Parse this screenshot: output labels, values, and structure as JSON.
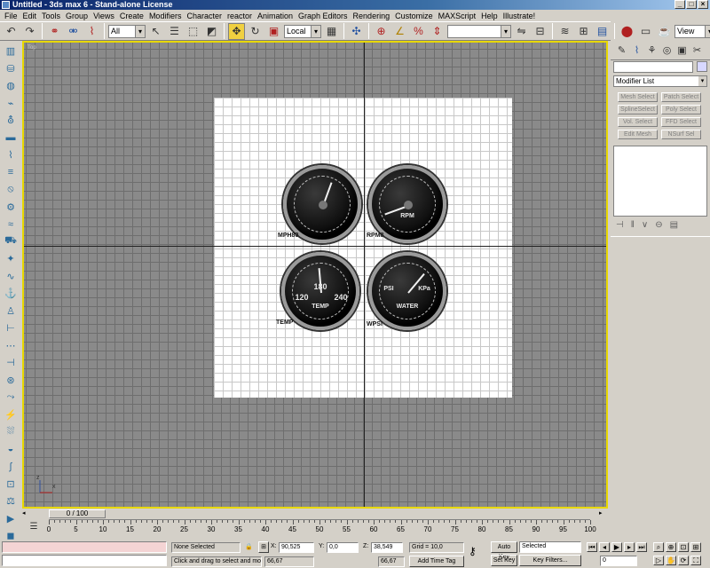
{
  "window": {
    "title": "Untitled - 3ds max 6 - Stand-alone License",
    "buttons": [
      "_",
      "□",
      "×"
    ]
  },
  "menu": [
    "File",
    "Edit",
    "Tools",
    "Group",
    "Views",
    "Create",
    "Modifiers",
    "Character",
    "reactor",
    "Animation",
    "Graph Editors",
    "Rendering",
    "Customize",
    "MAXScript",
    "Help",
    "Illustrate!"
  ],
  "toolbar": {
    "selection_filter": "All",
    "ref_coord": "Local",
    "named_selection": "",
    "render_type": "View"
  },
  "viewport": {
    "label": "Top",
    "gauges": [
      {
        "label": "MPH80",
        "face_text": ""
      },
      {
        "label": "RPM8",
        "face_text": "RPM"
      },
      {
        "label": "TEMP",
        "face_text": "TEMP",
        "scale": [
          "120",
          "180",
          "240"
        ]
      },
      {
        "label": "WPSI",
        "face_text": "WATER",
        "scale": [
          "PSI",
          "KPa"
        ]
      }
    ],
    "axis_z": "z",
    "axis_x": "x"
  },
  "cmdpanel": {
    "modifier_list": "Modifier List",
    "buttons": [
      "Mesh Select",
      "Patch Select",
      "SplineSelect",
      "Poly Select",
      "Vol. Select",
      "FFD Select",
      "Edit Mesh",
      "NSurf Sel"
    ]
  },
  "timeline": {
    "slider": "0 / 100",
    "ticks": [
      "0",
      "5",
      "10",
      "15",
      "20",
      "25",
      "30",
      "35",
      "40",
      "45",
      "50",
      "55",
      "60",
      "65",
      "70",
      "75",
      "80",
      "85",
      "90",
      "95",
      "100"
    ]
  },
  "status": {
    "selection": "None Selected",
    "prompt": "Click and drag to select and mov",
    "x_label": "X:",
    "x_value": "90,525",
    "y_label": "Y:",
    "y_value": "0,0",
    "z_label": "Z:",
    "z_value": "38,549",
    "grid": "Grid = 10,0",
    "add_time_tag": "Add Time Tag",
    "coord_a": "66,67",
    "coord_b": "66,67",
    "auto_key": "Auto Key",
    "set_key": "Set Key",
    "key_mode": "Selected",
    "key_filters": "Key Filters...",
    "frame": "0"
  }
}
